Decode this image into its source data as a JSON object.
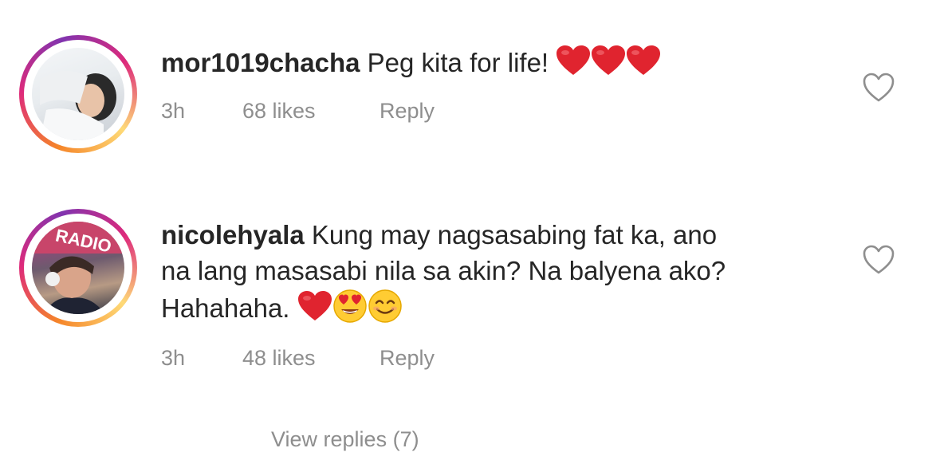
{
  "comments": [
    {
      "username": "mor1019chacha",
      "text": "Peg kita for life!",
      "emojis": [
        "red-heart",
        "red-heart",
        "red-heart"
      ],
      "time": "3h",
      "likes": "68 likes",
      "reply_label": "Reply"
    },
    {
      "username": "nicolehyala",
      "text_line1": "Kung may nagsasabing fat ka, ano",
      "text_line2": "na lang masasabi nila sa akin? Na balyena ako?",
      "text_line3": "Hahahaha.",
      "emojis": [
        "red-heart",
        "heart-eyes-face",
        "smiling-face"
      ],
      "time": "3h",
      "likes": "48 likes",
      "reply_label": "Reply"
    }
  ],
  "view_replies_label": "View replies (7)",
  "colors": {
    "text": "#262626",
    "meta": "#8e8e8e",
    "heart": "#e0242f",
    "emoji_face": "#ffcc33"
  }
}
